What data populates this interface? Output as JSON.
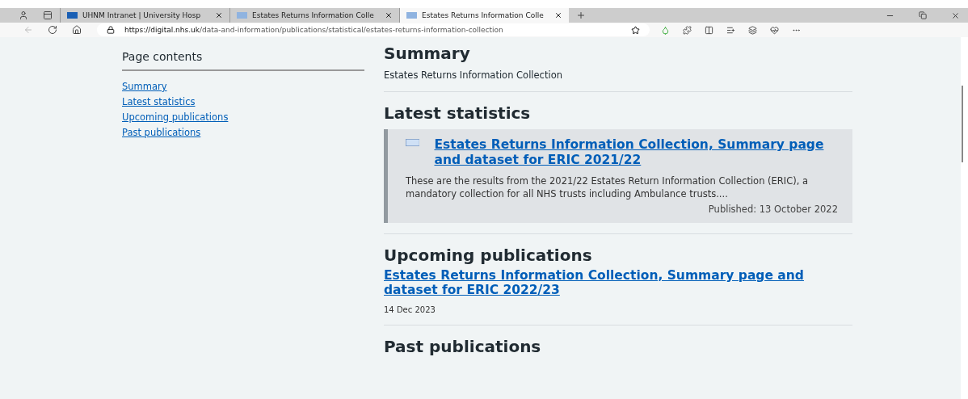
{
  "browser": {
    "tabs": [
      {
        "title": "UHNM Intranet | University Hosp",
        "selected": false,
        "kind": "nhs"
      },
      {
        "title": "Estates Returns Information Colle",
        "selected": false,
        "kind": "digital"
      },
      {
        "title": "Estates Returns Information Colle",
        "selected": true,
        "kind": "digital"
      }
    ],
    "url_host": "https://digital.nhs.uk",
    "url_path": "/data-and-information/publications/statistical/estates-returns-information-collection"
  },
  "page_contents": {
    "title": "Page contents",
    "links": [
      "Summary",
      "Latest statistics",
      "Upcoming publications",
      "Past publications"
    ]
  },
  "summary": {
    "heading": "Summary",
    "text": "Estates Returns Information Collection"
  },
  "latest": {
    "heading": "Latest statistics",
    "card": {
      "title": "Estates Returns Information Collection, Summary page and dataset for ERIC 2021/22",
      "description": "These are the results from the 2021/22 Estates Return Information Collection (ERIC), a mandatory collection for all NHS trusts including Ambulance trusts....",
      "published": "Published: 13 October 2022"
    }
  },
  "upcoming": {
    "heading": "Upcoming publications",
    "link": "Estates Returns Information Collection, Summary page and dataset for ERIC 2022/23",
    "date": "14 Dec 2023"
  },
  "past": {
    "heading": "Past publications"
  }
}
